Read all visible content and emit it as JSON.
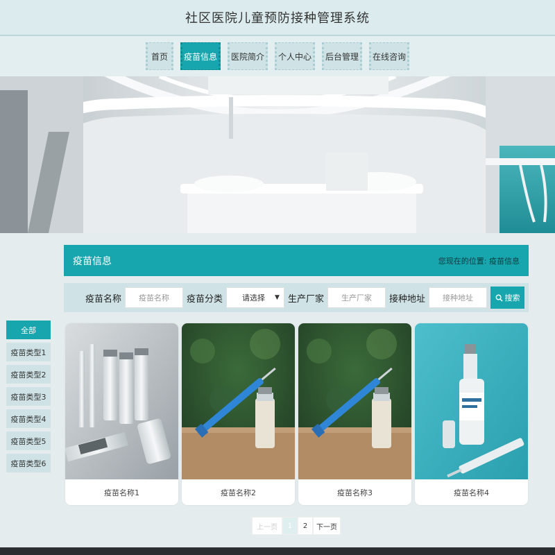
{
  "header": {
    "title": "社区医院儿童预防接种管理系统"
  },
  "nav": {
    "items": [
      {
        "label": "首页"
      },
      {
        "label": "疫苗信息"
      },
      {
        "label": "医院简介"
      },
      {
        "label": "个人中心"
      },
      {
        "label": "后台管理"
      },
      {
        "label": "在线咨询"
      }
    ],
    "active_index": 1
  },
  "section": {
    "title": "疫苗信息",
    "location_prefix": "您现在的位置:",
    "location_current": "疫苗信息"
  },
  "search": {
    "name_label": "疫苗名称",
    "name_placeholder": "疫苗名称",
    "category_label": "疫苗分类",
    "category_selected": "请选择",
    "manufacturer_label": "生产厂家",
    "manufacturer_placeholder": "生产厂家",
    "address_label": "接种地址",
    "address_placeholder": "接种地址",
    "button_label": "搜索"
  },
  "categories": {
    "items": [
      "全部",
      "疫苗类型1",
      "疫苗类型2",
      "疫苗类型3",
      "疫苗类型4",
      "疫苗类型5",
      "疫苗类型6"
    ],
    "active_index": 0
  },
  "cards": [
    {
      "name": "疫苗名称1"
    },
    {
      "name": "疫苗名称2"
    },
    {
      "name": "疫苗名称3"
    },
    {
      "name": "疫苗名称4"
    }
  ],
  "pager": {
    "prev": "上一页",
    "pages": [
      "1",
      "2"
    ],
    "current": "1",
    "next": "下一页"
  },
  "colors": {
    "accent": "#17a6ad",
    "nav_bg": "#cfe3e6",
    "page_bg": "#e4ecee"
  }
}
